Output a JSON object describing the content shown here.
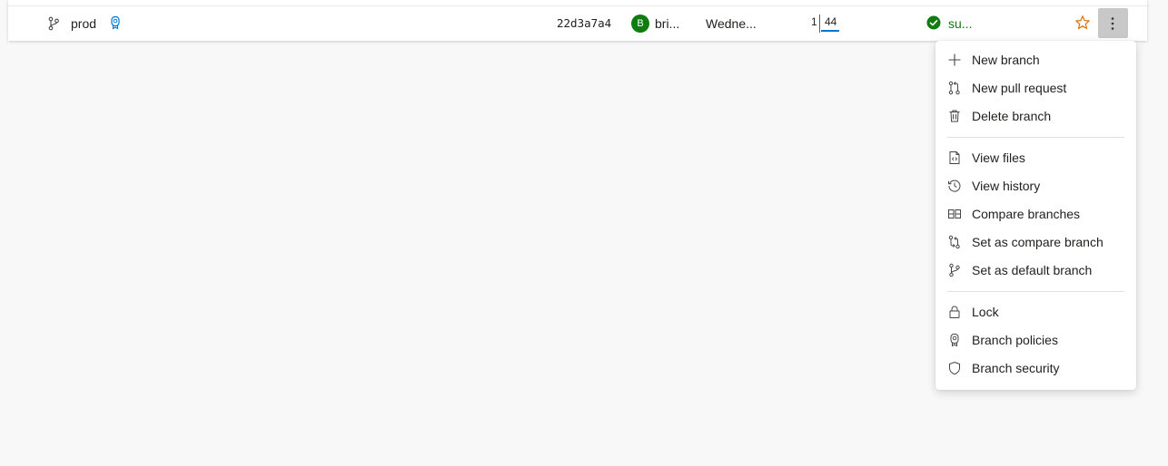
{
  "branch_row": {
    "branch_name": "prod",
    "commit": "22d3a7a4",
    "author_initial": "B",
    "author": "bri...",
    "date": "Wedne...",
    "behind": "1",
    "ahead": "44",
    "status": "su...",
    "colors": {
      "avatar": "#107c10",
      "status": "#107c10",
      "star": "#d9730d",
      "ahead_bar": "#0078d4",
      "policy_icon": "#0078d4"
    }
  },
  "menu": {
    "items": [
      {
        "label": "New branch",
        "icon": "plus-icon"
      },
      {
        "label": "New pull request",
        "icon": "pull-request-icon"
      },
      {
        "label": "Delete branch",
        "icon": "trash-icon"
      },
      {
        "label": "View files",
        "icon": "file-code-icon"
      },
      {
        "label": "View history",
        "icon": "history-icon"
      },
      {
        "label": "Compare branches",
        "icon": "compare-icon"
      },
      {
        "label": "Set as compare branch",
        "icon": "set-compare-icon"
      },
      {
        "label": "Set as default branch",
        "icon": "branch-icon"
      },
      {
        "label": "Lock",
        "icon": "lock-icon"
      },
      {
        "label": "Branch policies",
        "icon": "policy-icon"
      },
      {
        "label": "Branch security",
        "icon": "shield-icon"
      }
    ]
  }
}
